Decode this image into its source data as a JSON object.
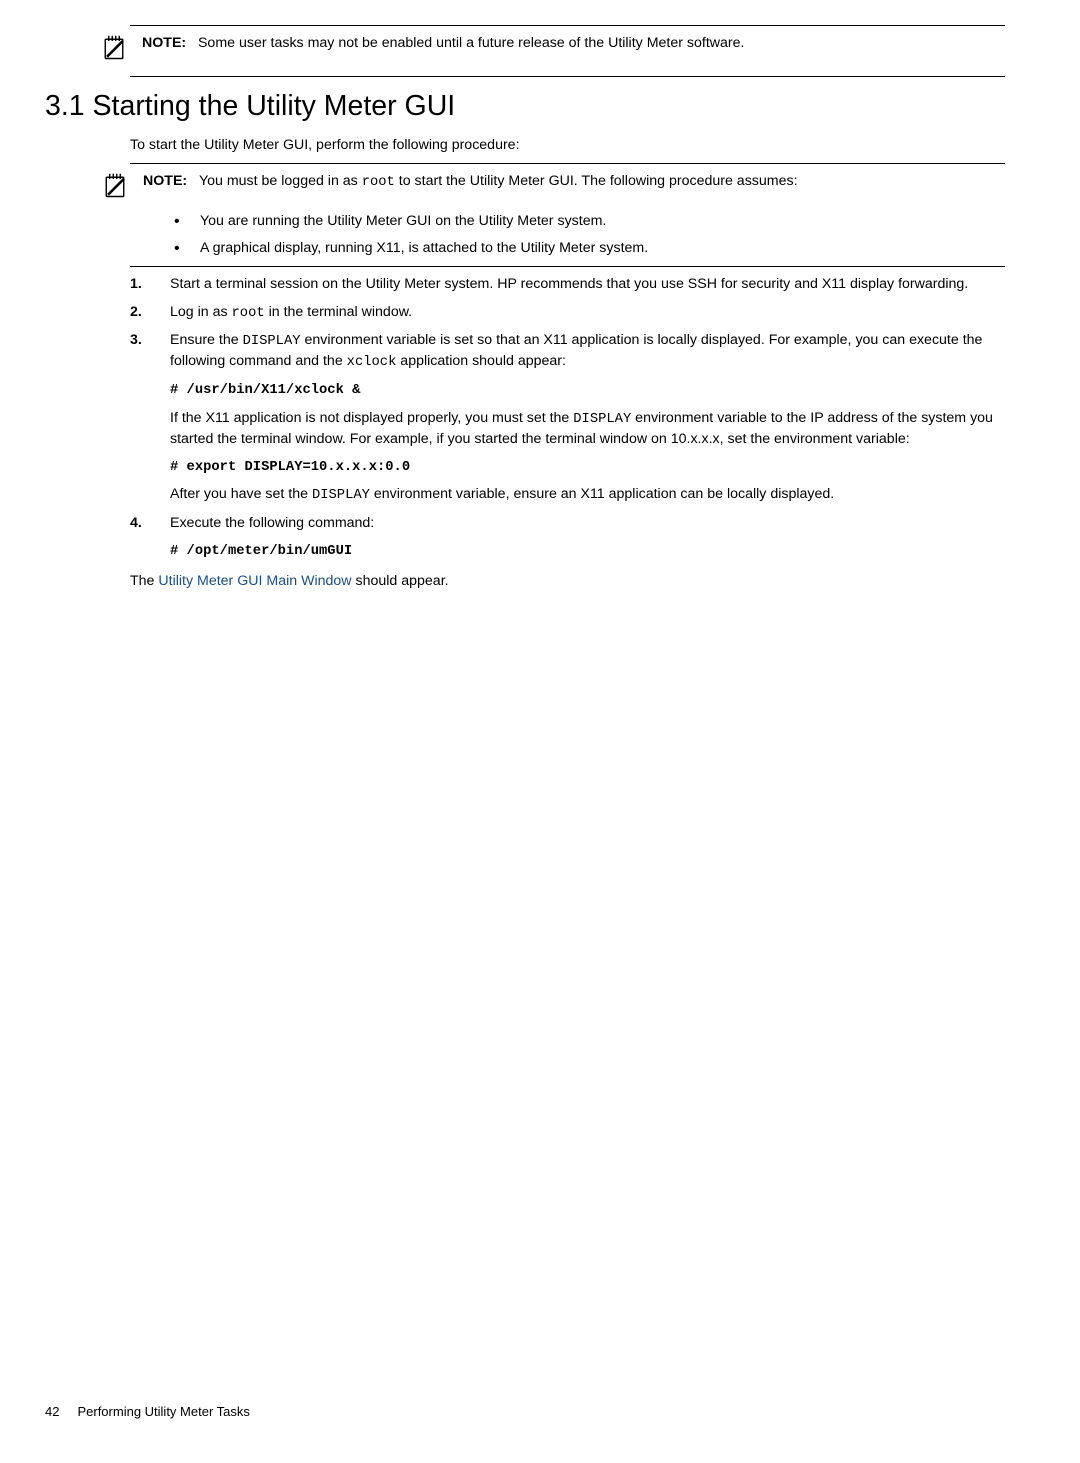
{
  "note1": {
    "label": "NOTE:",
    "text": "Some user tasks may not be enabled until a future release of the Utility Meter software."
  },
  "heading": "3.1 Starting the Utility Meter GUI",
  "intro": "To start the Utility Meter GUI, perform the following procedure:",
  "note2": {
    "label": "NOTE:",
    "pre": "You must be logged in as ",
    "code": "root",
    "post": " to start the Utility Meter GUI. The following procedure assumes:",
    "bullets": [
      "You are running the Utility Meter GUI on the Utility Meter system.",
      "A graphical display, running X11, is attached to the Utility Meter system."
    ]
  },
  "steps": {
    "s1": "Start a terminal session on the Utility Meter system. HP recommends that you use SSH for security and X11 display forwarding.",
    "s2_pre": "Log in as ",
    "s2_code": "root",
    "s2_post": " in the terminal window.",
    "s3_pre": "Ensure the ",
    "s3_code1": "DISPLAY",
    "s3_mid": " environment variable is set so that an X11 application is locally displayed. For example, you can execute the following command and the ",
    "s3_code2": "xclock",
    "s3_post": " application should appear:",
    "s3_cmd": "# /usr/bin/X11/xclock &",
    "s3_p2_pre": "If the X11 application is not displayed properly, you must set the ",
    "s3_p2_code": "DISPLAY",
    "s3_p2_post": " environment variable to the IP address of the system you started the terminal window. For example, if you started the terminal window on 10.x.x.x, set the environment variable:",
    "s3_cmd2": "# export DISPLAY=10.x.x.x:0.0",
    "s3_p3_pre": "After you have set the ",
    "s3_p3_code": "DISPLAY",
    "s3_p3_post": " environment variable, ensure an X11 application can be locally displayed.",
    "s4": "Execute the following command:",
    "s4_cmd": "# /opt/meter/bin/umGUI"
  },
  "final_pre": "The ",
  "final_link": "Utility Meter GUI Main Window",
  "final_post": " should appear.",
  "footer": {
    "page": "42",
    "title": "Performing Utility Meter Tasks"
  }
}
